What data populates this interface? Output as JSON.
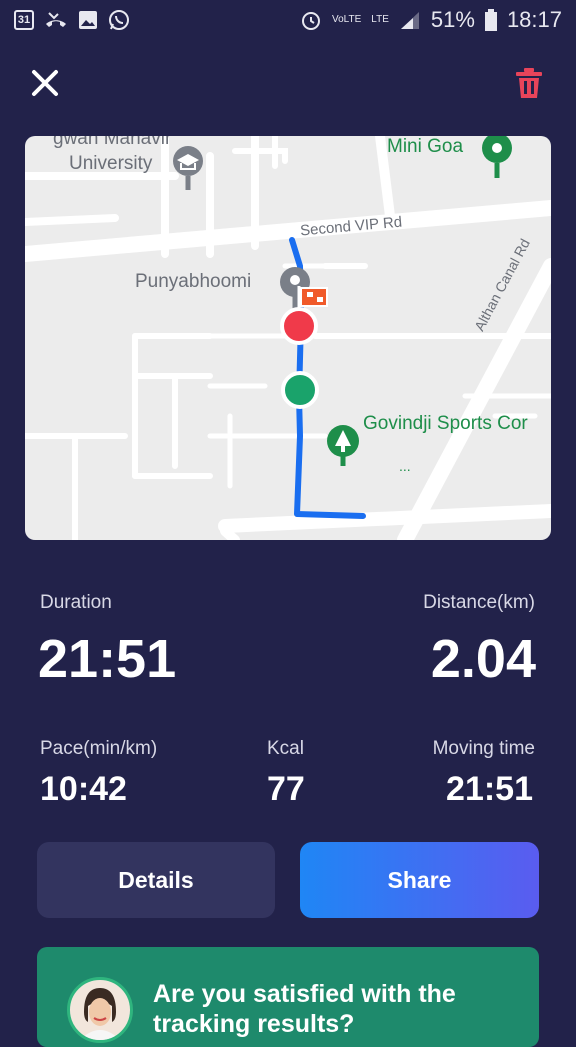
{
  "status_bar": {
    "calendar_day": "31",
    "left_icons": [
      "calendar-icon",
      "missed-call-icon",
      "gallery-icon",
      "whatsapp-icon"
    ],
    "volte": "VoLTE",
    "lte": "LTE",
    "battery_percent": "51%",
    "time": "18:17"
  },
  "header": {
    "close_icon": "close-icon",
    "delete_icon": "trash-icon",
    "delete_color": "#e8445a"
  },
  "map": {
    "labels": {
      "university_line1": "gwan Mahavir",
      "university_line2": "University",
      "mini_goa": "Mini Goa",
      "second_vip_rd": "Second VIP Rd",
      "punyabhoomi": "Punyabhoomi",
      "althan_canal_rd": "Althan Canal Rd",
      "govindji": "Govindji Sports Cor",
      "dots": "..."
    },
    "route_color": "#1a6ef0",
    "start_color": "#1aa36b",
    "end_color": "#f03a4a"
  },
  "stats": {
    "duration_label": "Duration",
    "duration_value": "21:51",
    "distance_label": "Distance(km)",
    "distance_value": "2.04",
    "pace_label": "Pace(min/km)",
    "pace_value": "10:42",
    "kcal_label": "Kcal",
    "kcal_value": "77",
    "moving_label": "Moving time",
    "moving_value": "21:51"
  },
  "buttons": {
    "details": "Details",
    "share": "Share"
  },
  "feedback": {
    "question": "Are you satisfied with the tracking results?"
  }
}
